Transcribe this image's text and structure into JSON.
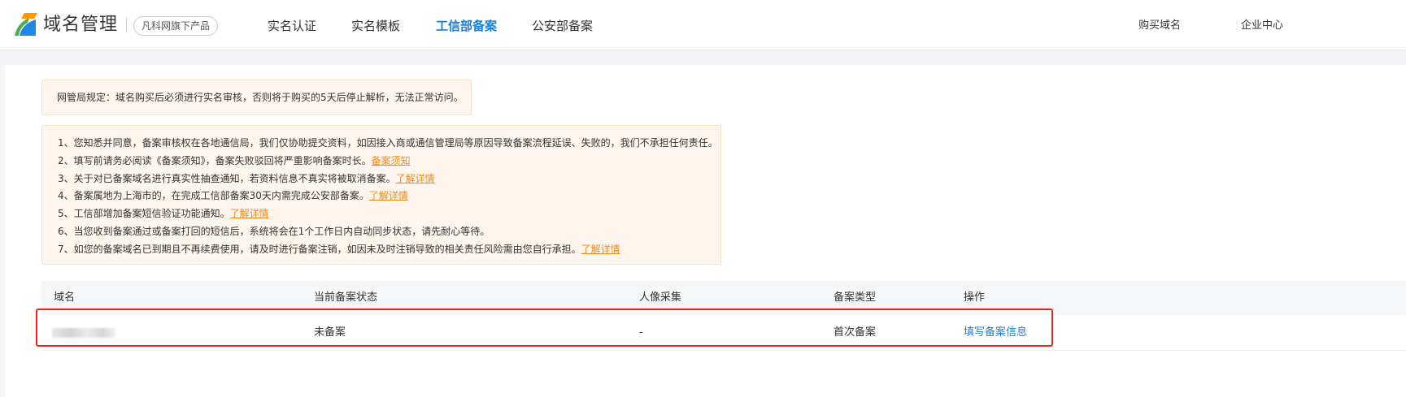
{
  "header": {
    "brand": "域名管理",
    "badge": "凡科网旗下产品",
    "nav": [
      {
        "label": "实名认证",
        "active": false
      },
      {
        "label": "实名模板",
        "active": false
      },
      {
        "label": "工信部备案",
        "active": true
      },
      {
        "label": "公安部备案",
        "active": false
      }
    ],
    "right": [
      "购买域名",
      "企业中心"
    ]
  },
  "notice_short": "网管局规定：域名购买后必须进行实名审核，否则将于购买的5天后停止解析，无法正常访问。",
  "notice_list": [
    {
      "text": "1、您知悉并同意，备案审核权在各地通信局，我们仅协助提交资料，如因接入商或通信管理局等原因导致备案流程延误、失败的，我们不承担任何责任。",
      "link": ""
    },
    {
      "text": "2、填写前请务必阅读《备案须知》，备案失败驳回将严重影响备案时长。",
      "link": "备案须知"
    },
    {
      "text": "3、关于对已备案域名进行真实性抽查通知，若资料信息不真实将被取消备案。",
      "link": "了解详情"
    },
    {
      "text": "4、备案属地为上海市的，在完成工信部备案30天内需完成公安部备案。",
      "link": "了解详情"
    },
    {
      "text": "5、工信部增加备案短信验证功能通知。",
      "link": "了解详情"
    },
    {
      "text": "6、当您收到备案通过或备案打回的短信后，系统将会在1个工作日内自动同步状态，请先耐心等待。",
      "link": ""
    },
    {
      "text": "7、如您的备案域名已到期且不再续费使用，请及时进行备案注销，如因未及时注销导致的相关责任风险需由您自行承担。",
      "link": "了解详情"
    }
  ],
  "table": {
    "columns": [
      "域名",
      "当前备案状态",
      "人像采集",
      "备案类型",
      "操作"
    ],
    "rows": [
      {
        "domain": "",
        "status": "未备案",
        "face": "-",
        "type": "首次备案",
        "action": "填写备案信息"
      }
    ]
  },
  "colors": {
    "accent": "#1a7fe0",
    "link_orange": "#f08a1c",
    "highlight_red": "#e8231e",
    "notice_bg": "#fef6ee"
  }
}
